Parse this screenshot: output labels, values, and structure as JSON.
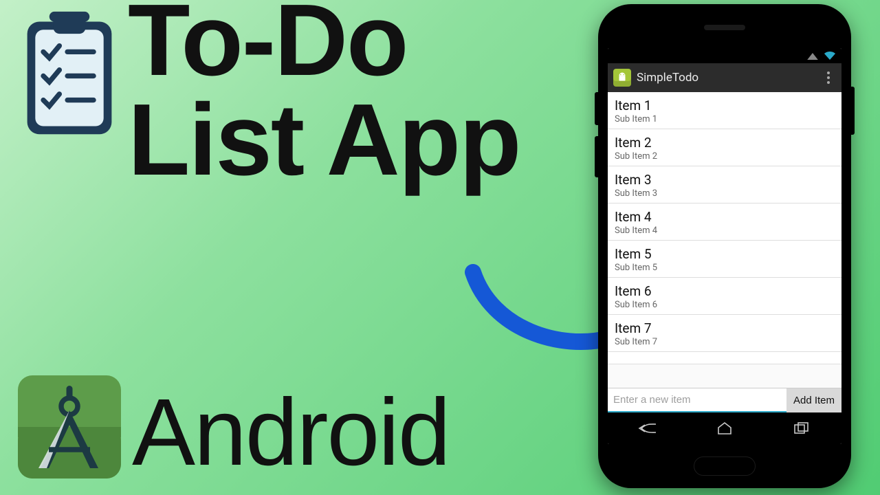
{
  "headline": {
    "line1": "To-Do",
    "line2": "List App"
  },
  "platform_label": "Android",
  "arrow_color": "#1558d6",
  "phone": {
    "status": {
      "wifi_color": "#2aa9c9"
    },
    "action_bar": {
      "title": "SimpleTodo"
    },
    "list_items": [
      {
        "title": "Item 1",
        "sub": "Sub Item 1"
      },
      {
        "title": "Item 2",
        "sub": "Sub Item 2"
      },
      {
        "title": "Item 3",
        "sub": "Sub Item 3"
      },
      {
        "title": "Item 4",
        "sub": "Sub Item 4"
      },
      {
        "title": "Item 5",
        "sub": "Sub Item 5"
      },
      {
        "title": "Item 6",
        "sub": "Sub Item 6"
      },
      {
        "title": "Item 7",
        "sub": "Sub Item 7"
      }
    ],
    "input": {
      "placeholder": "Enter a new item"
    },
    "add_button_label": "Add Item"
  },
  "clipboard_colors": {
    "board": "#1f3b57",
    "paper": "#e2f0f6",
    "clip": "#1f3b57"
  },
  "studio_colors": {
    "bg": "#5d9c4a",
    "compass": "#1c3a43"
  }
}
